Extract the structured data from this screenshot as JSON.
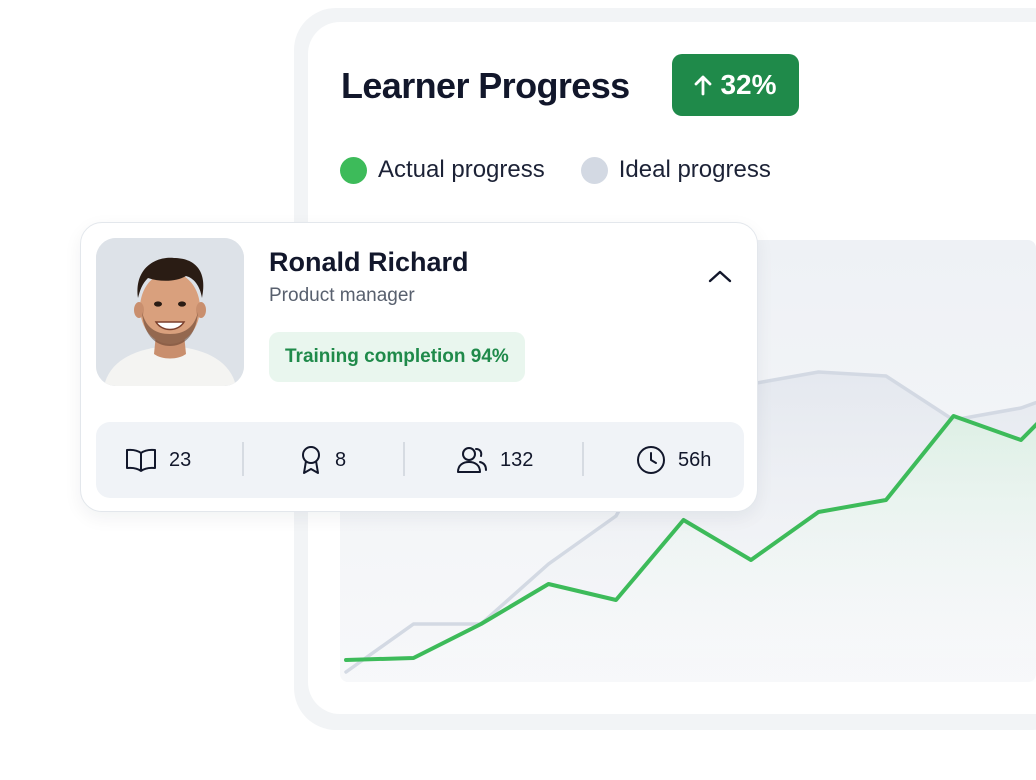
{
  "dashboard": {
    "title": "Learner Progress",
    "growth": "32%",
    "legend": [
      {
        "label": "Actual progress",
        "color": "#3dbb5a"
      },
      {
        "label": "Ideal progress",
        "color": "#d3d9e3"
      }
    ]
  },
  "learner": {
    "name": "Ronald Richard",
    "role": "Product manager",
    "completion_label": "Training completion 94%",
    "stats": [
      {
        "icon": "book-icon",
        "value": "23"
      },
      {
        "icon": "award-icon",
        "value": "8"
      },
      {
        "icon": "users-icon",
        "value": "132"
      },
      {
        "icon": "clock-icon",
        "value": "56h"
      }
    ]
  },
  "chart_data": {
    "type": "line",
    "title": "Learner Progress",
    "x": [
      0,
      1,
      2,
      3,
      4,
      5,
      6,
      7,
      8,
      9,
      10,
      11
    ],
    "series": [
      {
        "name": "Actual progress",
        "color": "#3dbb5a",
        "values": [
          5,
          5.5,
          14,
          24,
          20,
          40,
          30,
          42,
          45,
          66,
          60,
          77
        ]
      },
      {
        "name": "Ideal progress",
        "color": "#d3d9e3",
        "values": [
          2,
          14,
          14,
          29,
          41,
          71,
          74,
          77,
          76,
          65,
          68,
          74
        ]
      }
    ],
    "ylim": [
      0,
      110
    ],
    "grid": false
  }
}
